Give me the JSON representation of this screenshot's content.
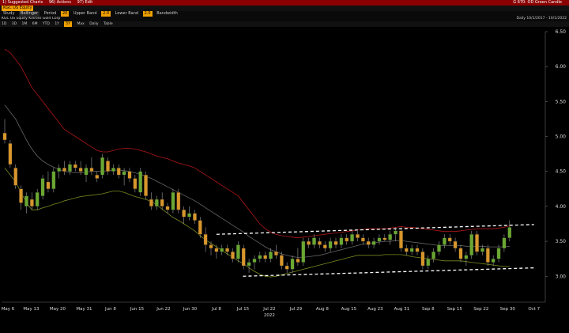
{
  "topbar": {
    "items": [
      "1) Suggested Charts",
      "96) Actions",
      "97) Edit"
    ],
    "right": "G 670: OD Green Candle"
  },
  "security_field": "KGC US Equity",
  "row3": {
    "study": "Study",
    "study_val": "Bollinger",
    "period_label": "Period",
    "period_val": "20",
    "upper_label": "Upper Band",
    "upper_val": "2.0",
    "lower_label": "Lower Band",
    "lower_val": "2.0",
    "bandwidth_label": "Bandwidth"
  },
  "row4": {
    "left": "KGC US Equity  Kinross Gold Corp",
    "daily": "Daily",
    "range": "10/1/2017 - 10/1/2022"
  },
  "row5": {
    "tabs": [
      "1D",
      "3D",
      "1M",
      "6M",
      "YTD",
      "1Y",
      "5Y",
      "Max",
      "Daily"
    ],
    "selected": "5Y",
    "table": "Table"
  },
  "colors": {
    "up": "#6aa832",
    "down": "#d8962c",
    "upper_band": "#b01818",
    "lower_band": "#7a8a20",
    "mid_band": "#666666",
    "trendline": "#ffffff"
  },
  "chart_data": {
    "type": "candlestick",
    "ylim": [
      2.72,
      6.5
    ],
    "yticks": [
      "3.00",
      "3.50",
      "4.00",
      "4.50",
      "5.00",
      "5.50",
      "6.00",
      "6.50"
    ],
    "xticks": [
      "May 6",
      "May 13",
      "May 20",
      "May 31",
      "Jun 8",
      "Jun 15",
      "Jun 22",
      "Jun 30",
      "Jul 8",
      "Jul 15",
      "Jul 22",
      "Jul 29",
      "Aug 8",
      "Aug 15",
      "Aug 23",
      "Aug 31",
      "Sep 8",
      "Sep 15",
      "Sep 22",
      "Sep 30",
      "Oct 7"
    ],
    "year_label": "2022",
    "candles": [
      {
        "o": 5.05,
        "h": 5.25,
        "l": 4.9,
        "c": 4.95
      },
      {
        "o": 4.9,
        "h": 4.95,
        "l": 4.55,
        "c": 4.6
      },
      {
        "o": 4.55,
        "h": 4.6,
        "l": 4.25,
        "c": 4.3
      },
      {
        "o": 4.25,
        "h": 4.3,
        "l": 3.95,
        "c": 4.05
      },
      {
        "o": 4.0,
        "h": 4.2,
        "l": 3.9,
        "c": 4.15
      },
      {
        "o": 4.1,
        "h": 4.2,
        "l": 3.95,
        "c": 4.0
      },
      {
        "o": 4.0,
        "h": 4.25,
        "l": 3.95,
        "c": 4.2
      },
      {
        "o": 4.15,
        "h": 4.45,
        "l": 4.1,
        "c": 4.4
      },
      {
        "o": 4.35,
        "h": 4.5,
        "l": 4.2,
        "c": 4.25
      },
      {
        "o": 4.25,
        "h": 4.55,
        "l": 4.2,
        "c": 4.5
      },
      {
        "o": 4.5,
        "h": 4.6,
        "l": 4.4,
        "c": 4.55
      },
      {
        "o": 4.55,
        "h": 4.65,
        "l": 4.45,
        "c": 4.5
      },
      {
        "o": 4.5,
        "h": 4.65,
        "l": 4.45,
        "c": 4.6
      },
      {
        "o": 4.6,
        "h": 4.65,
        "l": 4.5,
        "c": 4.55
      },
      {
        "o": 4.55,
        "h": 4.65,
        "l": 4.45,
        "c": 4.5
      },
      {
        "o": 4.45,
        "h": 4.6,
        "l": 4.35,
        "c": 4.55
      },
      {
        "o": 4.55,
        "h": 4.7,
        "l": 4.45,
        "c": 4.5
      },
      {
        "o": 4.45,
        "h": 4.5,
        "l": 4.35,
        "c": 4.4
      },
      {
        "o": 4.45,
        "h": 4.75,
        "l": 4.4,
        "c": 4.7
      },
      {
        "o": 4.65,
        "h": 4.7,
        "l": 4.45,
        "c": 4.5
      },
      {
        "o": 4.5,
        "h": 4.6,
        "l": 4.45,
        "c": 4.55
      },
      {
        "o": 4.55,
        "h": 4.6,
        "l": 4.4,
        "c": 4.45
      },
      {
        "o": 4.45,
        "h": 4.55,
        "l": 4.3,
        "c": 4.5
      },
      {
        "o": 4.5,
        "h": 4.55,
        "l": 4.35,
        "c": 4.4
      },
      {
        "o": 4.4,
        "h": 4.45,
        "l": 4.2,
        "c": 4.25
      },
      {
        "o": 4.2,
        "h": 4.55,
        "l": 4.15,
        "c": 4.5
      },
      {
        "o": 4.45,
        "h": 4.5,
        "l": 4.1,
        "c": 4.15
      },
      {
        "o": 4.1,
        "h": 4.2,
        "l": 3.95,
        "c": 4.0
      },
      {
        "o": 4.0,
        "h": 4.15,
        "l": 3.95,
        "c": 4.1
      },
      {
        "o": 4.1,
        "h": 4.2,
        "l": 3.95,
        "c": 4.0
      },
      {
        "o": 4.0,
        "h": 4.05,
        "l": 3.9,
        "c": 3.95
      },
      {
        "o": 3.95,
        "h": 4.25,
        "l": 3.9,
        "c": 4.2
      },
      {
        "o": 4.2,
        "h": 4.25,
        "l": 3.9,
        "c": 3.95
      },
      {
        "o": 3.95,
        "h": 4.0,
        "l": 3.75,
        "c": 3.85
      },
      {
        "o": 3.85,
        "h": 4.0,
        "l": 3.8,
        "c": 3.9
      },
      {
        "o": 3.9,
        "h": 3.95,
        "l": 3.75,
        "c": 3.8
      },
      {
        "o": 3.8,
        "h": 3.85,
        "l": 3.55,
        "c": 3.6
      },
      {
        "o": 3.6,
        "h": 3.7,
        "l": 3.35,
        "c": 3.45
      },
      {
        "o": 3.45,
        "h": 3.5,
        "l": 3.3,
        "c": 3.4
      },
      {
        "o": 3.4,
        "h": 3.45,
        "l": 3.25,
        "c": 3.35
      },
      {
        "o": 3.35,
        "h": 3.45,
        "l": 3.3,
        "c": 3.4
      },
      {
        "o": 3.4,
        "h": 3.45,
        "l": 3.3,
        "c": 3.35
      },
      {
        "o": 3.35,
        "h": 3.4,
        "l": 3.2,
        "c": 3.25
      },
      {
        "o": 3.25,
        "h": 3.5,
        "l": 3.2,
        "c": 3.45
      },
      {
        "o": 3.4,
        "h": 3.45,
        "l": 3.1,
        "c": 3.15
      },
      {
        "o": 3.15,
        "h": 3.25,
        "l": 3.05,
        "c": 3.2
      },
      {
        "o": 3.2,
        "h": 3.3,
        "l": 3.1,
        "c": 3.25
      },
      {
        "o": 3.25,
        "h": 3.35,
        "l": 3.2,
        "c": 3.3
      },
      {
        "o": 3.3,
        "h": 3.35,
        "l": 3.2,
        "c": 3.25
      },
      {
        "o": 3.25,
        "h": 3.4,
        "l": 3.2,
        "c": 3.35
      },
      {
        "o": 3.35,
        "h": 3.45,
        "l": 3.25,
        "c": 3.3
      },
      {
        "o": 3.3,
        "h": 3.35,
        "l": 3.1,
        "c": 3.15
      },
      {
        "o": 3.15,
        "h": 3.2,
        "l": 3.05,
        "c": 3.1
      },
      {
        "o": 3.1,
        "h": 3.3,
        "l": 3.05,
        "c": 3.25
      },
      {
        "o": 3.25,
        "h": 3.4,
        "l": 3.15,
        "c": 3.2
      },
      {
        "o": 3.2,
        "h": 3.55,
        "l": 3.15,
        "c": 3.5
      },
      {
        "o": 3.5,
        "h": 3.55,
        "l": 3.4,
        "c": 3.45
      },
      {
        "o": 3.45,
        "h": 3.6,
        "l": 3.4,
        "c": 3.55
      },
      {
        "o": 3.5,
        "h": 3.55,
        "l": 3.4,
        "c": 3.45
      },
      {
        "o": 3.45,
        "h": 3.5,
        "l": 3.35,
        "c": 3.4
      },
      {
        "o": 3.4,
        "h": 3.55,
        "l": 3.35,
        "c": 3.5
      },
      {
        "o": 3.5,
        "h": 3.55,
        "l": 3.4,
        "c": 3.45
      },
      {
        "o": 3.45,
        "h": 3.6,
        "l": 3.4,
        "c": 3.55
      },
      {
        "o": 3.55,
        "h": 3.6,
        "l": 3.45,
        "c": 3.5
      },
      {
        "o": 3.5,
        "h": 3.65,
        "l": 3.45,
        "c": 3.6
      },
      {
        "o": 3.6,
        "h": 3.65,
        "l": 3.5,
        "c": 3.55
      },
      {
        "o": 3.55,
        "h": 3.6,
        "l": 3.45,
        "c": 3.5
      },
      {
        "o": 3.5,
        "h": 3.55,
        "l": 3.4,
        "c": 3.45
      },
      {
        "o": 3.45,
        "h": 3.55,
        "l": 3.4,
        "c": 3.5
      },
      {
        "o": 3.5,
        "h": 3.6,
        "l": 3.45,
        "c": 3.55
      },
      {
        "o": 3.55,
        "h": 3.6,
        "l": 3.5,
        "c": 3.52
      },
      {
        "o": 3.52,
        "h": 3.65,
        "l": 3.45,
        "c": 3.6
      },
      {
        "o": 3.6,
        "h": 3.7,
        "l": 3.5,
        "c": 3.65
      },
      {
        "o": 3.65,
        "h": 3.7,
        "l": 3.35,
        "c": 3.4
      },
      {
        "o": 3.4,
        "h": 3.45,
        "l": 3.3,
        "c": 3.35
      },
      {
        "o": 3.35,
        "h": 3.45,
        "l": 3.3,
        "c": 3.4
      },
      {
        "o": 3.4,
        "h": 3.45,
        "l": 3.3,
        "c": 3.35
      },
      {
        "o": 3.35,
        "h": 3.4,
        "l": 3.1,
        "c": 3.15
      },
      {
        "o": 3.15,
        "h": 3.3,
        "l": 3.1,
        "c": 3.25
      },
      {
        "o": 3.25,
        "h": 3.4,
        "l": 3.2,
        "c": 3.35
      },
      {
        "o": 3.35,
        "h": 3.5,
        "l": 3.3,
        "c": 3.45
      },
      {
        "o": 3.45,
        "h": 3.6,
        "l": 3.4,
        "c": 3.55
      },
      {
        "o": 3.55,
        "h": 3.6,
        "l": 3.45,
        "c": 3.5
      },
      {
        "o": 3.5,
        "h": 3.55,
        "l": 3.35,
        "c": 3.4
      },
      {
        "o": 3.4,
        "h": 3.45,
        "l": 3.2,
        "c": 3.25
      },
      {
        "o": 3.25,
        "h": 3.35,
        "l": 3.15,
        "c": 3.3
      },
      {
        "o": 3.3,
        "h": 3.65,
        "l": 3.25,
        "c": 3.6
      },
      {
        "o": 3.6,
        "h": 3.65,
        "l": 3.3,
        "c": 3.35
      },
      {
        "o": 3.35,
        "h": 3.45,
        "l": 3.3,
        "c": 3.4
      },
      {
        "o": 3.4,
        "h": 3.45,
        "l": 3.15,
        "c": 3.2
      },
      {
        "o": 3.2,
        "h": 3.3,
        "l": 3.15,
        "c": 3.25
      },
      {
        "o": 3.25,
        "h": 3.45,
        "l": 3.2,
        "c": 3.4
      },
      {
        "o": 3.4,
        "h": 3.6,
        "l": 3.35,
        "c": 3.55
      },
      {
        "o": 3.55,
        "h": 3.8,
        "l": 3.5,
        "c": 3.7
      }
    ],
    "upper_band": [
      6.25,
      6.2,
      6.1,
      6.0,
      5.85,
      5.7,
      5.6,
      5.5,
      5.4,
      5.3,
      5.2,
      5.1,
      5.05,
      5.0,
      4.95,
      4.9,
      4.85,
      4.8,
      4.78,
      4.78,
      4.8,
      4.82,
      4.83,
      4.83,
      4.82,
      4.8,
      4.78,
      4.75,
      4.72,
      4.7,
      4.68,
      4.65,
      4.62,
      4.6,
      4.58,
      4.55,
      4.5,
      4.45,
      4.4,
      4.35,
      4.3,
      4.25,
      4.2,
      4.15,
      4.05,
      3.95,
      3.85,
      3.75,
      3.68,
      3.63,
      3.6,
      3.58,
      3.57,
      3.56,
      3.55,
      3.56,
      3.57,
      3.58,
      3.59,
      3.6,
      3.61,
      3.62,
      3.63,
      3.64,
      3.65,
      3.66,
      3.67,
      3.68,
      3.68,
      3.68,
      3.68,
      3.69,
      3.7,
      3.71,
      3.7,
      3.7,
      3.69,
      3.68,
      3.67,
      3.66,
      3.65,
      3.64,
      3.64,
      3.64,
      3.65,
      3.66,
      3.67,
      3.68,
      3.68,
      3.68,
      3.68,
      3.69,
      3.7,
      3.72
    ],
    "mid_band": [
      5.45,
      5.35,
      5.25,
      5.1,
      4.95,
      4.82,
      4.72,
      4.65,
      4.6,
      4.56,
      4.53,
      4.5,
      4.49,
      4.48,
      4.48,
      4.49,
      4.5,
      4.5,
      4.5,
      4.51,
      4.52,
      4.52,
      4.51,
      4.5,
      4.48,
      4.46,
      4.43,
      4.4,
      4.36,
      4.32,
      4.28,
      4.24,
      4.2,
      4.16,
      4.12,
      4.08,
      4.03,
      3.98,
      3.93,
      3.88,
      3.83,
      3.78,
      3.73,
      3.68,
      3.63,
      3.57,
      3.52,
      3.47,
      3.42,
      3.38,
      3.35,
      3.32,
      3.3,
      3.28,
      3.27,
      3.27,
      3.28,
      3.29,
      3.3,
      3.32,
      3.34,
      3.36,
      3.38,
      3.4,
      3.42,
      3.44,
      3.46,
      3.47,
      3.48,
      3.49,
      3.5,
      3.5,
      3.51,
      3.51,
      3.5,
      3.49,
      3.48,
      3.47,
      3.46,
      3.45,
      3.44,
      3.44,
      3.44,
      3.44,
      3.44,
      3.43,
      3.43,
      3.43,
      3.43,
      3.42,
      3.42,
      3.42,
      3.42,
      3.43
    ],
    "lower_band": [
      4.55,
      4.45,
      4.35,
      4.2,
      4.05,
      3.95,
      3.95,
      3.98,
      4.0,
      4.03,
      4.05,
      4.08,
      4.1,
      4.12,
      4.14,
      4.15,
      4.16,
      4.17,
      4.18,
      4.2,
      4.22,
      4.22,
      4.2,
      4.17,
      4.14,
      4.12,
      4.1,
      4.07,
      4.02,
      3.96,
      3.9,
      3.84,
      3.8,
      3.75,
      3.7,
      3.65,
      3.58,
      3.52,
      3.47,
      3.42,
      3.37,
      3.32,
      3.27,
      3.22,
      3.18,
      3.12,
      3.07,
      3.03,
      3.0,
      2.99,
      3.0,
      3.02,
      3.04,
      3.06,
      3.08,
      3.1,
      3.12,
      3.14,
      3.16,
      3.18,
      3.2,
      3.22,
      3.24,
      3.26,
      3.28,
      3.3,
      3.3,
      3.3,
      3.3,
      3.3,
      3.31,
      3.31,
      3.31,
      3.31,
      3.3,
      3.28,
      3.27,
      3.26,
      3.25,
      3.24,
      3.23,
      3.22,
      3.22,
      3.22,
      3.22,
      3.21,
      3.2,
      3.19,
      3.18,
      3.17,
      3.16,
      3.15,
      3.14,
      3.14
    ],
    "trendlines": [
      {
        "from": {
          "x": "Jul 8",
          "y": 3.6
        },
        "to": {
          "x": "Oct 7",
          "y": 3.74
        }
      },
      {
        "from": {
          "x": "Jul 15",
          "y": 3.0
        },
        "to": {
          "x": "Oct 7",
          "y": 3.12
        }
      }
    ]
  }
}
